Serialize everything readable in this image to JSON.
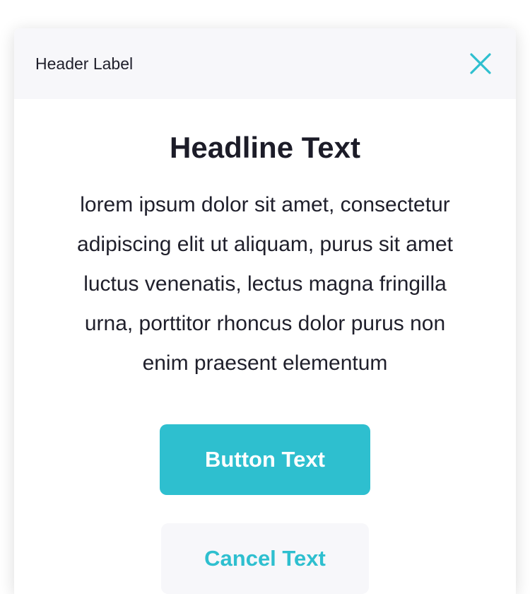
{
  "header": {
    "label": "Header Label",
    "close_icon": "close-icon"
  },
  "body": {
    "headline": "Headline Text",
    "text": "lorem ipsum dolor sit amet, consectetur adipiscing elit ut aliquam, purus sit amet luctus venenatis, lectus magna fringilla urna, porttitor rhoncus dolor purus non enim praesent elementum"
  },
  "actions": {
    "primary_label": "Button Text",
    "cancel_label": "Cancel Text"
  },
  "colors": {
    "accent": "#2EBFCF",
    "header_bg": "#F7F7FA",
    "text": "#1F1F2B"
  }
}
